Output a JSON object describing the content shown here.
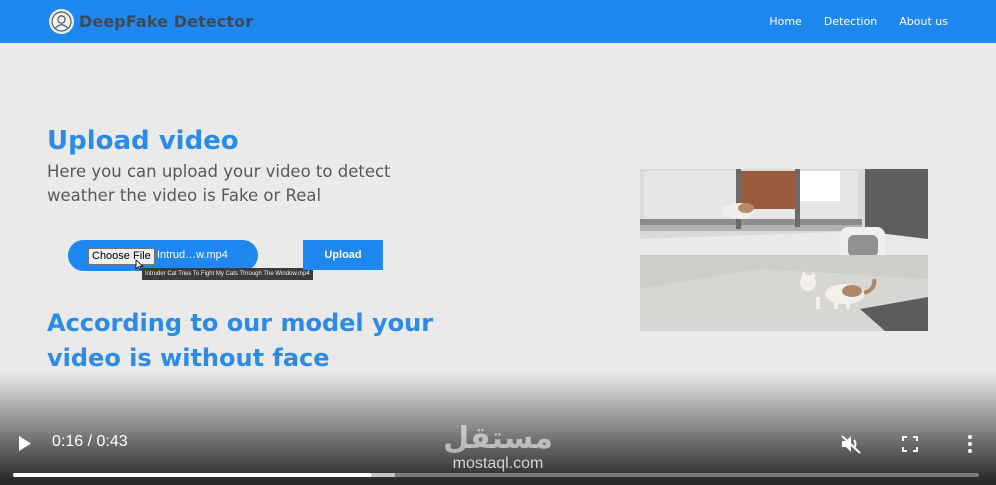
{
  "nav": {
    "brand": "DeepFake Detector",
    "links": [
      "Home",
      "Detection",
      "About us"
    ]
  },
  "upload": {
    "title": "Upload video",
    "description": "Here you can upload your video to detect weather the video is Fake or Real",
    "choose_label": "Choose File",
    "file_name": "Intrud…w.mp4",
    "tooltip": "Intruder Cat Tries To Fight My Cats Through The Window.mp4",
    "upload_label": "Upload"
  },
  "result": {
    "text": "According to our model your video is without face"
  },
  "player": {
    "time": "0:16 / 0:43",
    "progress": 0.372,
    "buffered": 0.395,
    "icons": [
      "play-icon",
      "muted-volume-icon",
      "fullscreen-icon",
      "more-options-icon"
    ]
  },
  "watermark": {
    "arabic": "مستقل",
    "latin": "mostaql.com"
  },
  "colors": {
    "nav": "#1e88f0",
    "accent_text": "#2b8be6",
    "background": "#eaeaea"
  }
}
